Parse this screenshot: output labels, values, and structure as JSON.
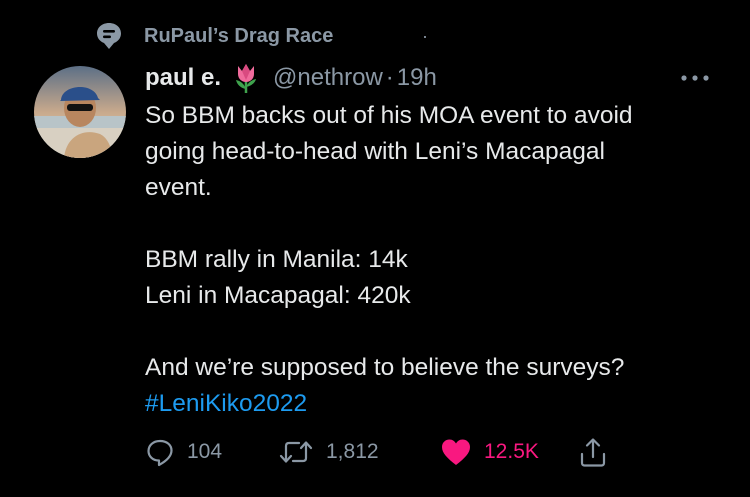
{
  "context": {
    "community": "RuPaul’s Drag Race",
    "separator": "·",
    "icon": "topic-bubble-icon"
  },
  "tweet": {
    "author_name": "paul e.",
    "name_emoji": "tulip-icon",
    "handle": "@nethrow",
    "separator": "·",
    "time": "19h",
    "more_icon": "more-dots-icon",
    "lines": [
      "So BBM backs out of his MOA event to avoid",
      "going head-to-head with Leni’s Macapagal",
      "event.",
      "",
      "BBM rally in Manila: 14k",
      "Leni in Macapagal: 420k",
      "",
      "And we’re supposed to believe the surveys?"
    ],
    "hashtag": "#LeniKiko2022"
  },
  "actions": {
    "reply_count": "104",
    "retweet_count": "1,812",
    "like_count": "12.5K"
  },
  "colors": {
    "background": "#000000",
    "text": "#e7e9ea",
    "muted": "#8b98a5",
    "link": "#1d9bf0",
    "like": "#f91880"
  }
}
